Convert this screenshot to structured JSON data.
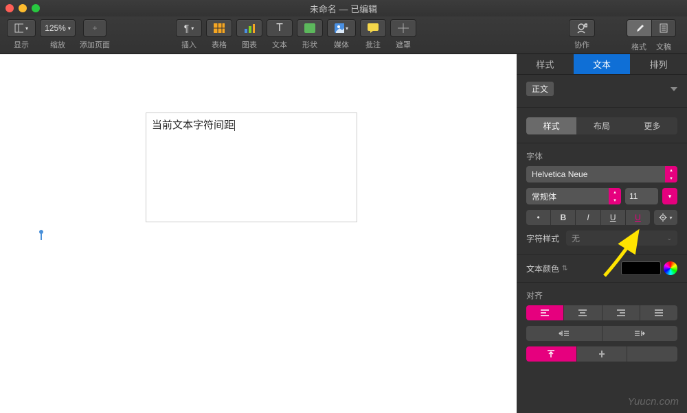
{
  "window": {
    "title": "未命名 — 已编辑"
  },
  "toolbar": {
    "view": "显示",
    "zoom": "缩放",
    "zoom_value": "125%",
    "add_page": "添加页面",
    "insert": "插入",
    "table": "表格",
    "chart": "图表",
    "text": "文本",
    "shape": "形状",
    "media": "媒体",
    "comment": "批注",
    "mask": "遮罩",
    "collab": "协作",
    "format": "格式",
    "document": "文稿"
  },
  "document": {
    "textbox_content": "当前文本字符间距"
  },
  "inspector": {
    "tabs": {
      "style": "样式",
      "text": "文本",
      "arrange": "排列"
    },
    "paragraph_style": "正文",
    "subtabs": {
      "style": "样式",
      "layout": "布局",
      "more": "更多"
    },
    "font_label": "字体",
    "font_family": "Helvetica Neue",
    "font_weight": "常规体",
    "font_size": "11",
    "bold": "B",
    "italic": "I",
    "underline": "U",
    "strike": "U",
    "char_style_label": "字符样式",
    "char_style_value": "无",
    "text_color_label": "文本颜色",
    "align_label": "对齐"
  },
  "watermark": "Yuucn.com"
}
